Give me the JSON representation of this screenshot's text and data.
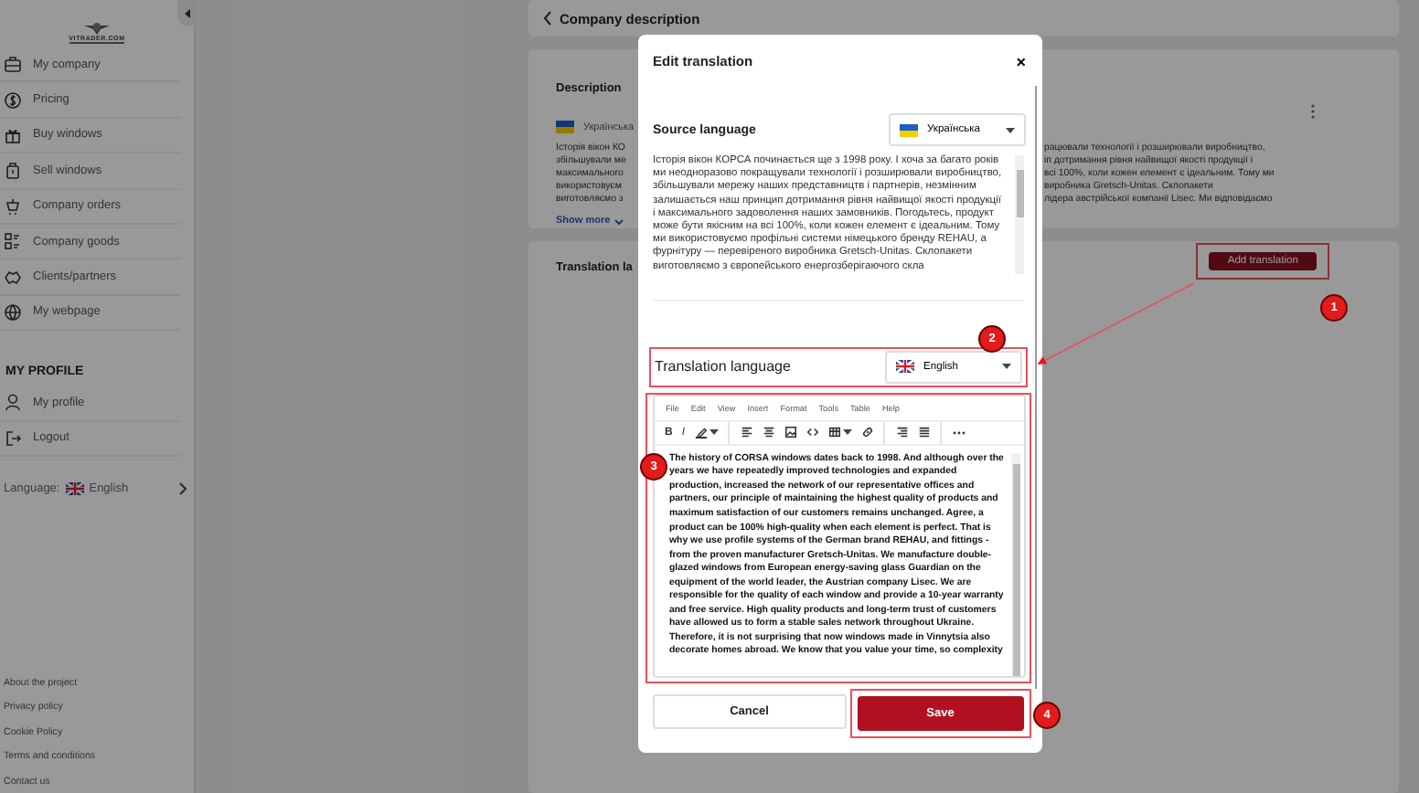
{
  "sidebar": {
    "logo": "VITRADER.COM",
    "menu": [
      {
        "label": "My company"
      },
      {
        "label": "Pricing"
      },
      {
        "label": "Buy windows"
      },
      {
        "label": "Sell windows"
      },
      {
        "label": "Company orders"
      },
      {
        "label": "Company goods"
      },
      {
        "label": "Clients/partners"
      },
      {
        "label": "My webpage"
      }
    ],
    "profile_heading": "MY PROFILE",
    "profile_menu": [
      {
        "label": "My profile"
      },
      {
        "label": "Logout"
      }
    ],
    "language": {
      "label": "Language:",
      "value": "English"
    },
    "footer_links": [
      "About the project",
      "Privacy policy",
      "Cookie Policy",
      "Terms and conditions",
      "Contact us"
    ]
  },
  "header": {
    "title": "Company description"
  },
  "description": {
    "title": "Description",
    "language": "Українська",
    "text_left": [
      "Історія вікон КО",
      "збільшували ме",
      "максимального",
      "використовуєм",
      "виготовляємо з"
    ],
    "text_right": [
      "рацювали технології і розширювали виробництво,",
      "іп дотримання рівня найвищої якості продукції і",
      "всі 100%, коли кожен елемент є ідеальним. Тому ми",
      "виробника Gretsch-Unitas. Склопакети",
      "лідера австрійської компанії Lisec. Ми відповідаємо"
    ],
    "show_more": "Show more"
  },
  "translations": {
    "title": "Translation la",
    "add_button": "Add translation"
  },
  "modal": {
    "title": "Edit translation",
    "close": "×",
    "source": {
      "label": "Source language",
      "language": "Українська",
      "text": "Історія вікон КОРСА починається ще з 1998 року. І хоча за багато років ми неодноразово покращували технології і розширювали виробництво, збільшували мережу наших представництв і партнерів, незмінним залишається наш принцип дотримання рівня найвищої якості продукції і максимального задоволення наших замовників. Погодьтесь, продукт може бути якісним на всі 100%, коли кожен елемент є ідеальним. Тому ми використовуємо профільні системи німецького бренду REHAU, а фурнітуру — перевіреного виробника Gretsch-Unitas. Склопакети виготовляємо з європейського енергозберігаючого скла"
    },
    "target": {
      "label": "Translation language",
      "language": "English"
    },
    "editor": {
      "menu": [
        "File",
        "Edit",
        "View",
        "Insert",
        "Format",
        "Tools",
        "Table",
        "Help"
      ],
      "toolbar": [
        {
          "kind": "bold",
          "label": "B"
        },
        {
          "kind": "italic",
          "label": "I"
        },
        {
          "kind": "highlight"
        },
        {
          "kind": "separator"
        },
        {
          "kind": "align-left"
        },
        {
          "kind": "align-center"
        },
        {
          "kind": "image"
        },
        {
          "kind": "code"
        },
        {
          "kind": "table"
        },
        {
          "kind": "link"
        },
        {
          "kind": "separator"
        },
        {
          "kind": "align-right"
        },
        {
          "kind": "justify"
        },
        {
          "kind": "separator"
        },
        {
          "kind": "more"
        }
      ],
      "text": "The history of CORSA windows dates back to 1998. And although over the years we have repeatedly improved technologies and expanded production, increased the network of our representative offices and partners, our principle of maintaining the highest quality of products and maximum satisfaction of our customers remains unchanged. Agree, a product can be 100% high-quality when each element is perfect. That is why we use profile systems of the German brand REHAU, and fittings - from the proven manufacturer Gretsch-Unitas. We manufacture double-glazed windows from European energy-saving glass Guardian on the equipment of the world leader, the Austrian company Lisec. We are responsible for the quality of each window and provide a 10-year warranty and free service. High quality products and long-term trust of customers have allowed us to form a stable sales network throughout Ukraine. Therefore, it is not surprising that now windows made in Vinnytsia also decorate homes abroad. We know that you value your time, so complexity"
    },
    "buttons": [
      {
        "kind": "secondary",
        "label": "Cancel"
      },
      {
        "kind": "primary",
        "label": "Save"
      }
    ]
  },
  "annotations": [
    {
      "label": "1"
    },
    {
      "label": "2"
    },
    {
      "label": "3"
    },
    {
      "label": "4"
    }
  ]
}
